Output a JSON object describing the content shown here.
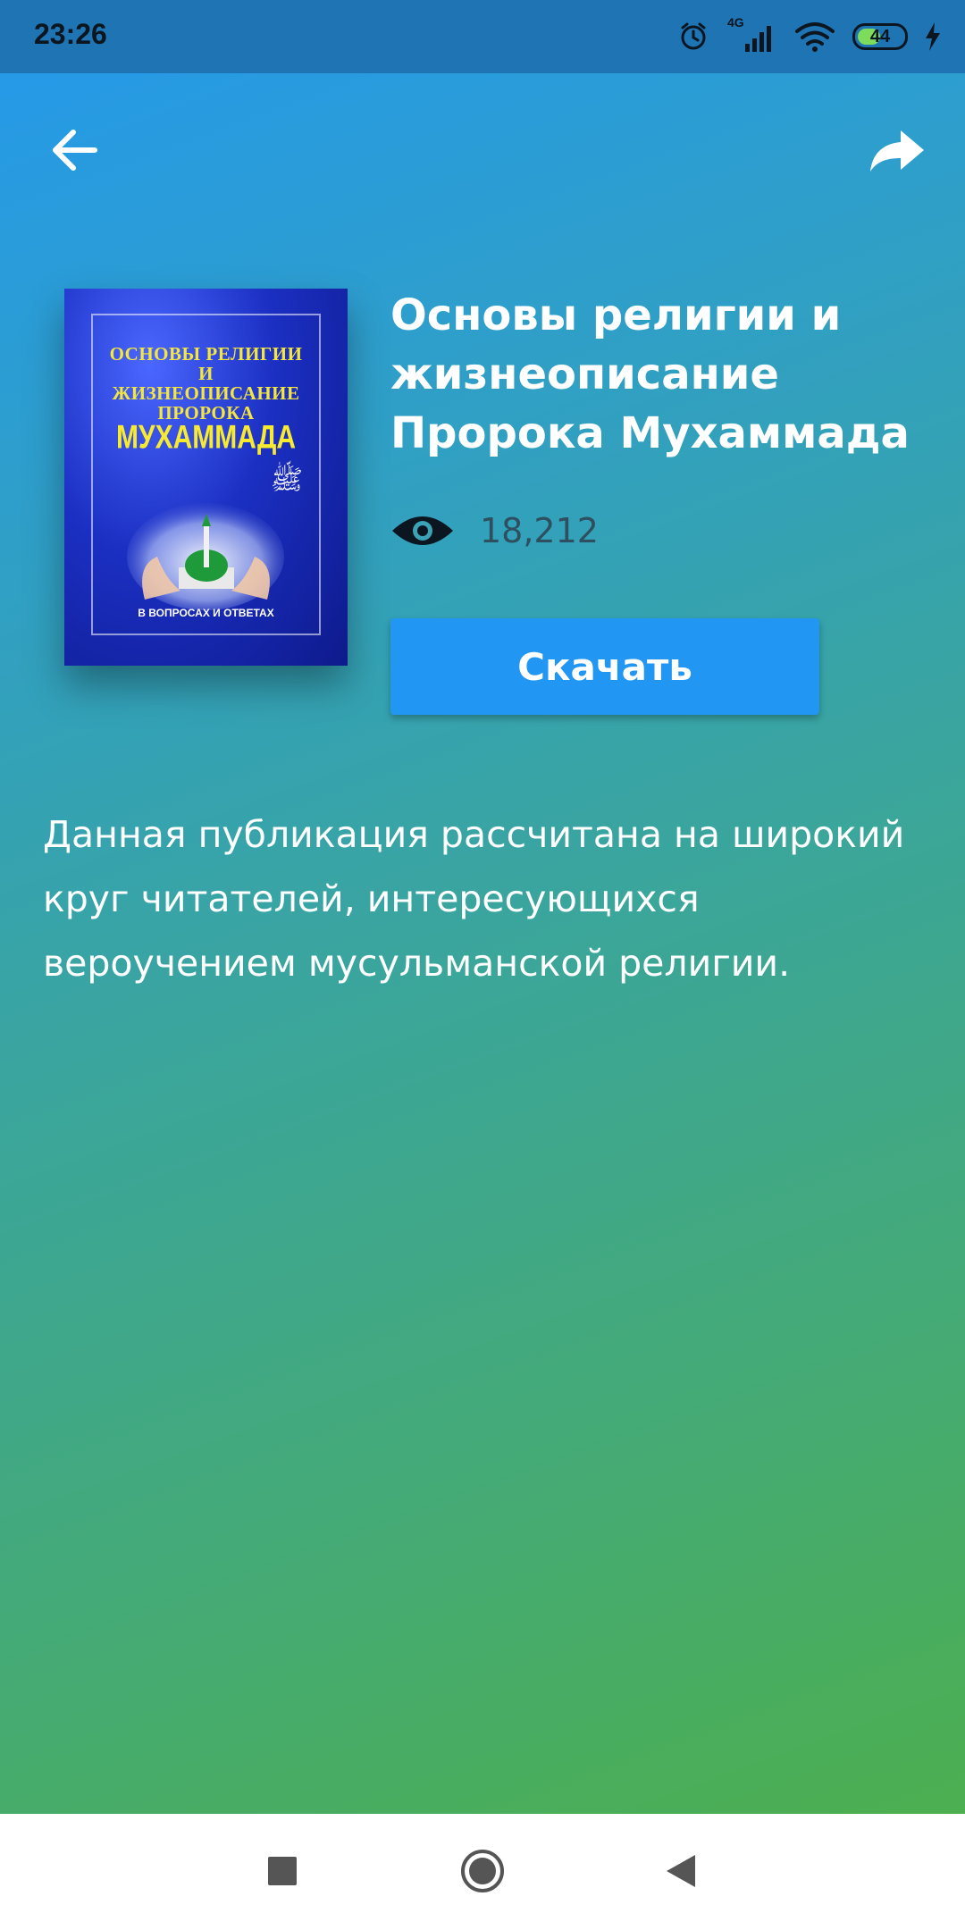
{
  "status_bar": {
    "time": "23:26",
    "network": "4G",
    "battery": "44"
  },
  "toolbar": {
    "back_icon": "arrow-left-icon",
    "share_icon": "share-icon"
  },
  "book": {
    "cover": {
      "title_lines": [
        "ОСНОВЫ РЕЛИГИИ",
        "И",
        "ЖИЗНЕОПИСАНИЕ",
        "ПРОРОКА"
      ],
      "main_name": "МУХАММАДА",
      "subtitle": "В ВОПРОСАХ И ОТВЕТАХ",
      "calligraphy": "ﷺ"
    },
    "title": "Основы религии и жизнеописание Пророка Мухаммада",
    "views": "18,212",
    "download_label": "Скачать",
    "description": "Данная публикация рассчитана на широкий круг читателей, интересующихся вероучением мусульманской религии."
  },
  "colors": {
    "status_bar": "#1f74b4",
    "gradient_start": "#2499ec",
    "gradient_end": "#4caf50",
    "button": "#2196f3",
    "views_text": "#2e4f60"
  },
  "nav_bar": {
    "recents_icon": "square-icon",
    "home_icon": "circle-icon",
    "back_icon": "triangle-back-icon"
  }
}
